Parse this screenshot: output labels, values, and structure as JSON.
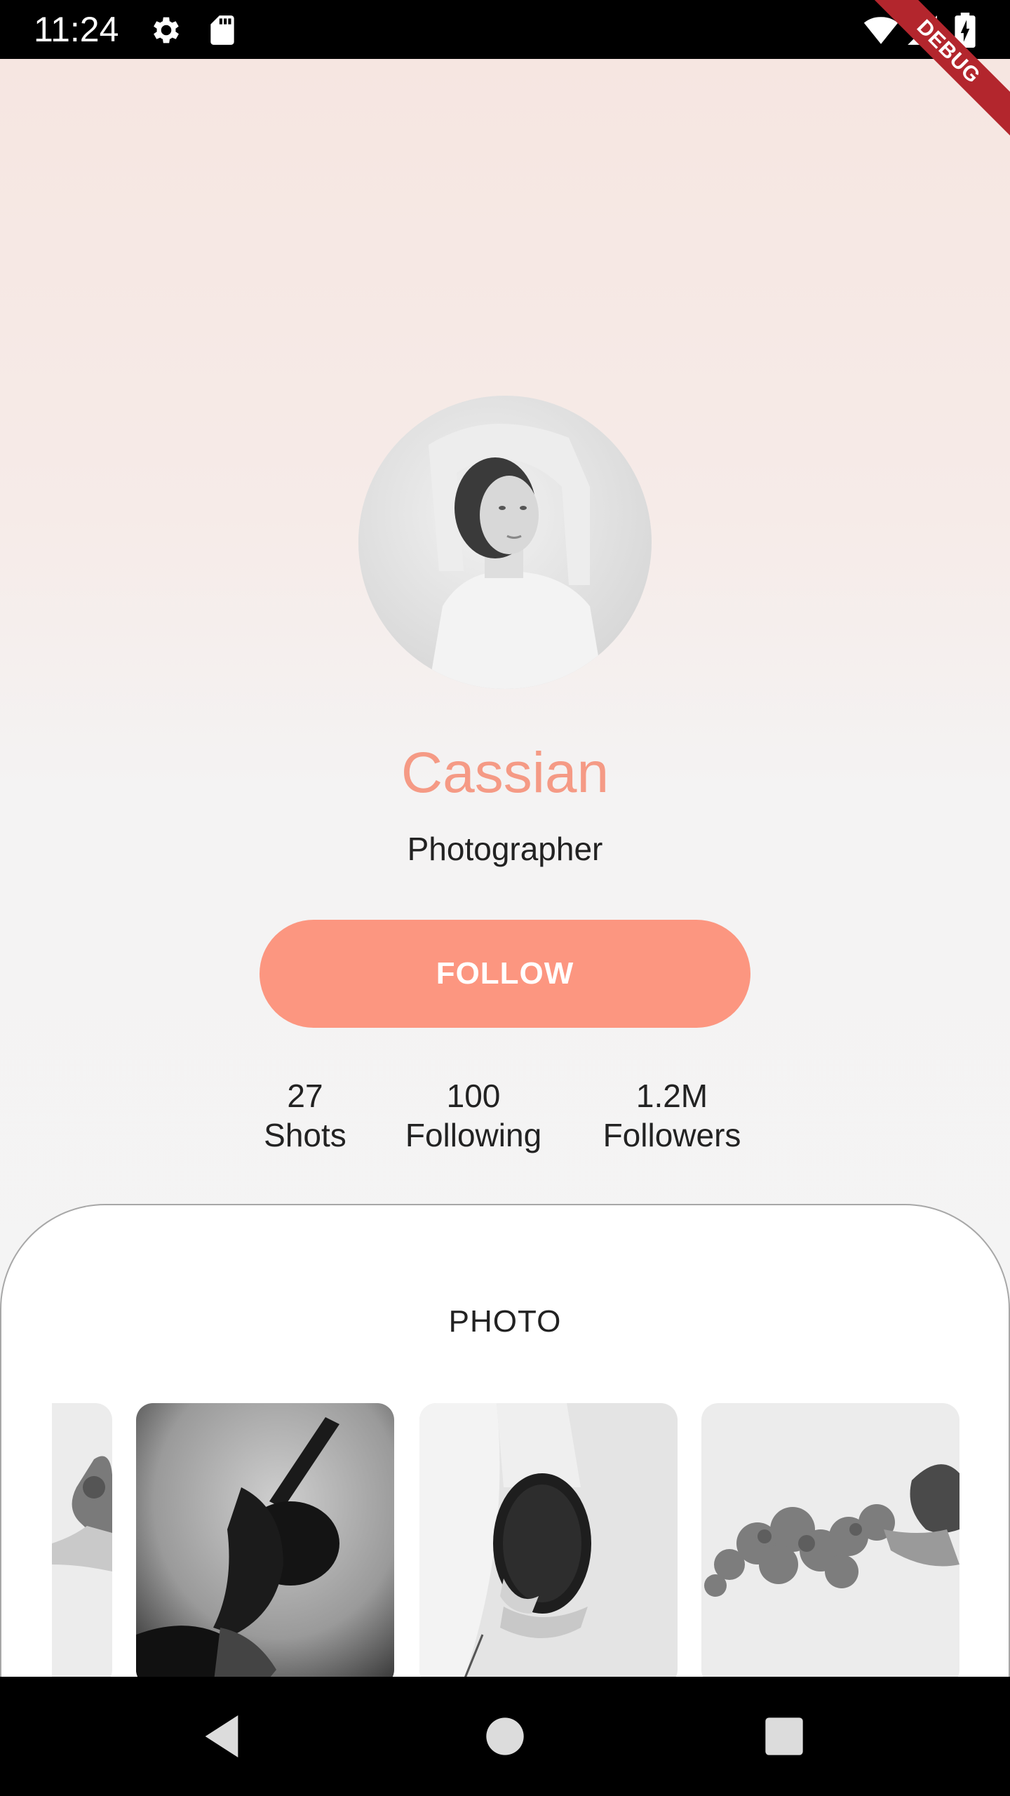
{
  "status_bar": {
    "time": "11:24",
    "icons": [
      "gear-icon",
      "sd-card-icon",
      "wifi-icon",
      "signal-icon",
      "battery-charging-icon"
    ]
  },
  "debug_banner": {
    "label": "DEBUG",
    "color": "#b3262d"
  },
  "profile": {
    "name": "Cassian",
    "role": "Photographer",
    "follow_label": "FOLLOW",
    "accent_color": "#fc9680"
  },
  "stats": [
    {
      "value": "27",
      "label": "Shots"
    },
    {
      "value": "100",
      "label": "Following"
    },
    {
      "value": "1.2M",
      "label": "Followers"
    }
  ],
  "gallery": {
    "title": "PHOTO",
    "photos": [
      "partial-flowers-photo",
      "dancer-photo",
      "fencing-mask-photo",
      "flowers-photo"
    ]
  },
  "nav_bar": {
    "buttons": [
      "back-icon",
      "home-icon",
      "recents-icon"
    ]
  }
}
